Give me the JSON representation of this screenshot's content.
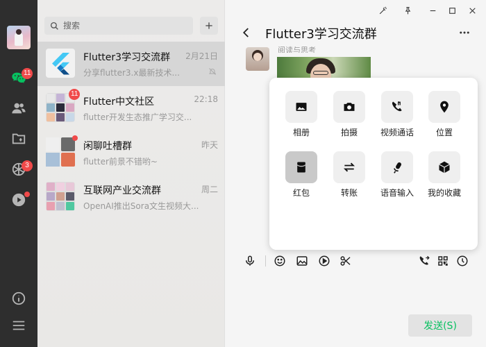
{
  "app": {
    "colors": {
      "accent": "#07c160",
      "rail": "#2e2e2e",
      "badge": "#f04a4a"
    }
  },
  "rail": {
    "items": [
      {
        "icon": "chat-icon",
        "badge": "11"
      },
      {
        "icon": "contacts-icon"
      },
      {
        "icon": "folder-icon"
      },
      {
        "icon": "moments-icon",
        "badge": "3"
      },
      {
        "icon": "video-channel-icon",
        "dot": true
      }
    ],
    "bottom": [
      {
        "icon": "info-icon"
      },
      {
        "icon": "menu-icon"
      }
    ]
  },
  "search": {
    "placeholder": "搜索"
  },
  "chats": [
    {
      "name": "Flutter3学习交流群",
      "time": "2月21日",
      "preview": "分享flutter3.x最新技术...",
      "muted": true,
      "active": true
    },
    {
      "name": "Flutter中文社区",
      "time": "22:18",
      "preview": "flutter开发生态推广学习交...",
      "badge": "11"
    },
    {
      "name": "闲聊吐槽群",
      "time": "昨天",
      "preview": "flutter前景不错哟~",
      "dot": true
    },
    {
      "name": "互联网产业交流群",
      "time": "周二",
      "preview": "OpenAI推出Sora文生视频大..."
    }
  ],
  "chat": {
    "title": "Flutter3学习交流群",
    "sender": "阅读与思考"
  },
  "panel": {
    "tools": [
      {
        "label": "相册",
        "icon": "photo-icon"
      },
      {
        "label": "拍摄",
        "icon": "camera-icon"
      },
      {
        "label": "视频通话",
        "icon": "video-call-icon"
      },
      {
        "label": "位置",
        "icon": "location-icon"
      },
      {
        "label": "红包",
        "icon": "red-packet-icon",
        "selected": true
      },
      {
        "label": "转账",
        "icon": "transfer-icon"
      },
      {
        "label": "语音输入",
        "icon": "voice-input-icon"
      },
      {
        "label": "我的收藏",
        "icon": "favorites-icon"
      }
    ]
  },
  "composer": {
    "send_label": "发送(S)"
  }
}
